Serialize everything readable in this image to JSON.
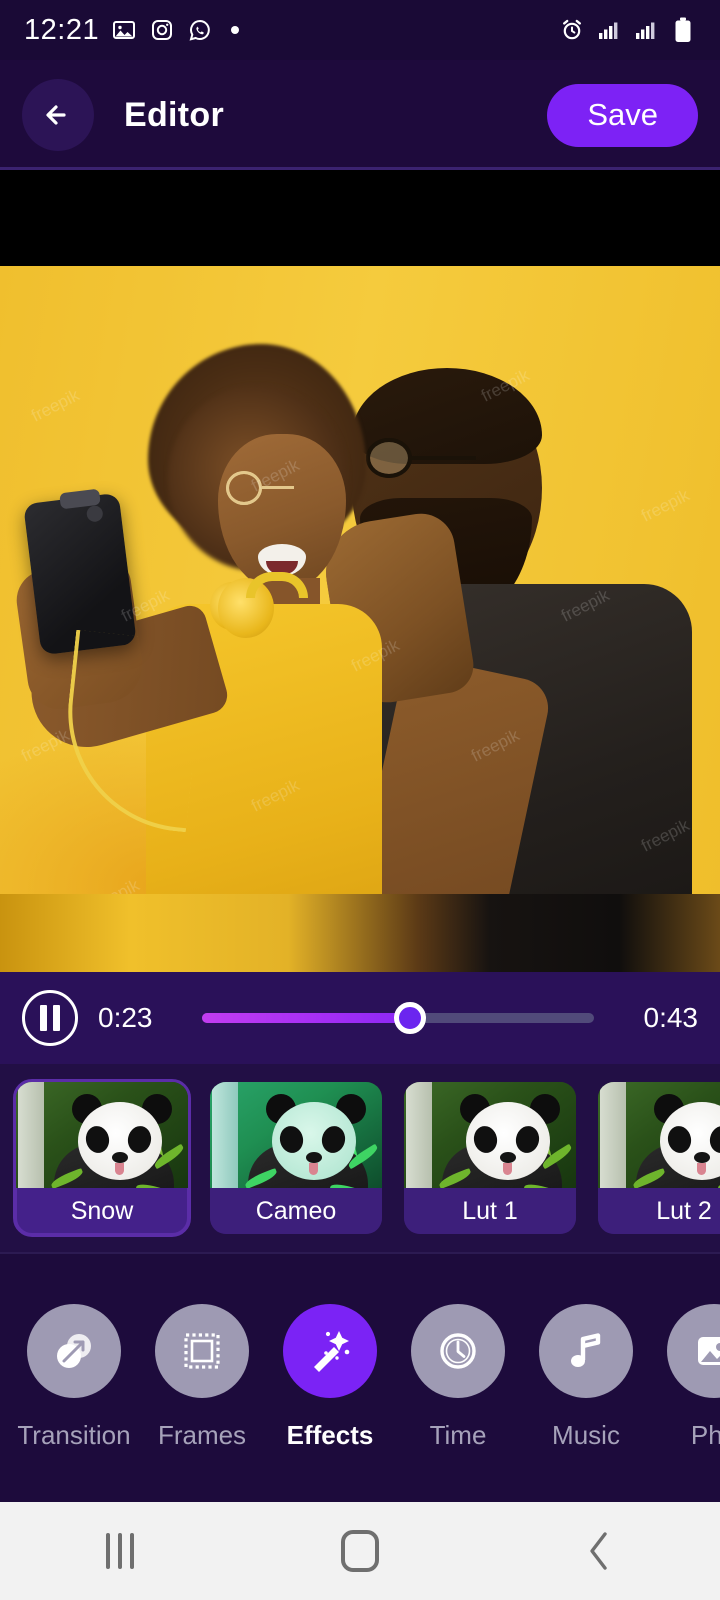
{
  "status_bar": {
    "time": "12:21",
    "left_icons": [
      "gallery-icon",
      "instagram-icon",
      "whatsapp-icon",
      "dot-indicator"
    ],
    "right_icons": [
      "alarm-icon",
      "signal-sim1-icon",
      "signal-sim2-icon",
      "battery-icon"
    ]
  },
  "header": {
    "back_icon": "arrow-left-icon",
    "title": "Editor",
    "save_label": "Save",
    "accent_color": "#7d22f5",
    "background_color": "#1e0a3c"
  },
  "preview": {
    "description": "Video preview of a woman taking a selfie with a surprised man against a yellow wall",
    "watermark_text": "freepik"
  },
  "player": {
    "play_state_icon": "pause-icon",
    "current_time": "0:23",
    "total_time": "0:43",
    "progress_percent": 53,
    "fill_color": "#a42ef5",
    "thumb_color": "#6b25ef"
  },
  "effects": {
    "selected": "Snow",
    "items": [
      {
        "label": "Snow",
        "selected": true
      },
      {
        "label": "Cameo",
        "selected": false
      },
      {
        "label": "Lut 1",
        "selected": false
      },
      {
        "label": "Lut 2",
        "selected": false
      }
    ]
  },
  "toolbar": {
    "active": "Effects",
    "items": [
      {
        "label": "Transition",
        "icon": "transition-icon",
        "active": false
      },
      {
        "label": "Frames",
        "icon": "frame-icon",
        "active": false
      },
      {
        "label": "Effects",
        "icon": "magic-wand-icon",
        "active": true
      },
      {
        "label": "Time",
        "icon": "clock-icon",
        "active": false
      },
      {
        "label": "Music",
        "icon": "music-note-icon",
        "active": false
      },
      {
        "label": "Pho",
        "icon": "photo-icon",
        "active": false
      }
    ]
  },
  "nav_bar": {
    "recents_icon": "recents-icon",
    "home_icon": "home-icon",
    "back_icon": "nav-back-icon"
  }
}
